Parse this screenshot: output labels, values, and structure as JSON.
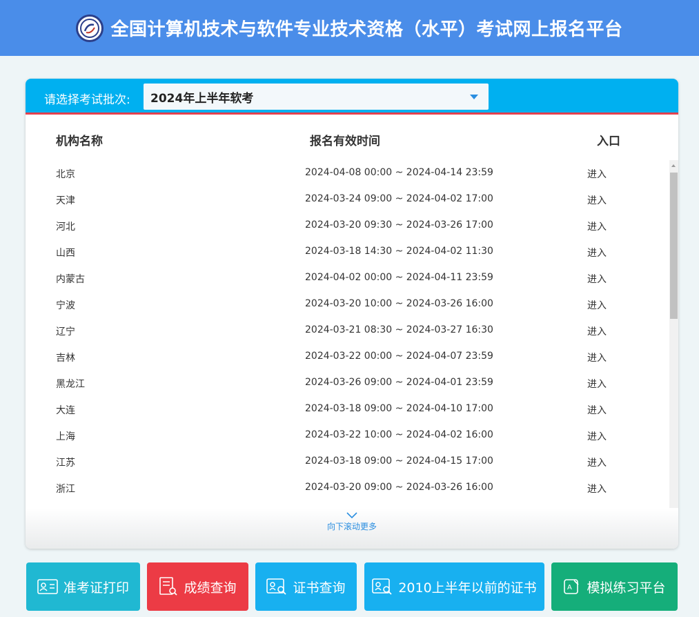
{
  "header": {
    "title": "全国计算机技术与软件专业技术资格（水平）考试网上报名平台"
  },
  "batch": {
    "label": "请选择考试批次:",
    "selected": "2024年上半年软考"
  },
  "table": {
    "columns": [
      "机构名称",
      "报名有效时间",
      "入口"
    ],
    "rows": [
      {
        "org": "北京",
        "time": "2024-04-08 00:00 ~ 2024-04-14 23:59",
        "entry": "进入"
      },
      {
        "org": "天津",
        "time": "2024-03-24 09:00 ~ 2024-04-02 17:00",
        "entry": "进入"
      },
      {
        "org": "河北",
        "time": "2024-03-20 09:30 ~ 2024-03-26 17:00",
        "entry": "进入"
      },
      {
        "org": "山西",
        "time": "2024-03-18 14:30 ~ 2024-04-02 11:30",
        "entry": "进入"
      },
      {
        "org": "内蒙古",
        "time": "2024-04-02 00:00 ~ 2024-04-11 23:59",
        "entry": "进入"
      },
      {
        "org": "宁波",
        "time": "2024-03-20 10:00 ~ 2024-03-26 16:00",
        "entry": "进入"
      },
      {
        "org": "辽宁",
        "time": "2024-03-21 08:30 ~ 2024-03-27 16:30",
        "entry": "进入"
      },
      {
        "org": "吉林",
        "time": "2024-03-22 00:00 ~ 2024-04-07 23:59",
        "entry": "进入"
      },
      {
        "org": "黑龙江",
        "time": "2024-03-26 09:00 ~ 2024-04-01 23:59",
        "entry": "进入"
      },
      {
        "org": "大连",
        "time": "2024-03-18 09:00 ~ 2024-04-10 17:00",
        "entry": "进入"
      },
      {
        "org": "上海",
        "time": "2024-03-22 10:00 ~ 2024-04-02 16:00",
        "entry": "进入"
      },
      {
        "org": "江苏",
        "time": "2024-03-18 09:00 ~ 2024-04-15 17:00",
        "entry": "进入"
      },
      {
        "org": "浙江",
        "time": "2024-03-20 09:00 ~ 2024-03-26 16:00",
        "entry": "进入"
      }
    ]
  },
  "scroll_more": "向下滚动更多",
  "buttons": {
    "admission": "准考证打印",
    "score": "成绩查询",
    "certificate": "证书查询",
    "old_certificate": "2010上半年以前的证书",
    "practice": "模拟练习平台"
  },
  "colors": {
    "header": "#4a8de9",
    "panel_head": "#00b0f0",
    "accent_line": "#e4414e",
    "btn_admission": "#20b8d2",
    "btn_score": "#ec3b45",
    "btn_certificate": "#18b0f0",
    "btn_practice": "#15ae7a"
  },
  "icons": {
    "logo": "logo-icon",
    "dropdown": "caret-down-icon",
    "scroll_more": "chevron-down-icon",
    "admission": "id-card-icon",
    "score": "document-search-icon",
    "certificate": "certificate-search-icon",
    "old_certificate": "certificate-search-icon",
    "practice": "edit-icon"
  }
}
